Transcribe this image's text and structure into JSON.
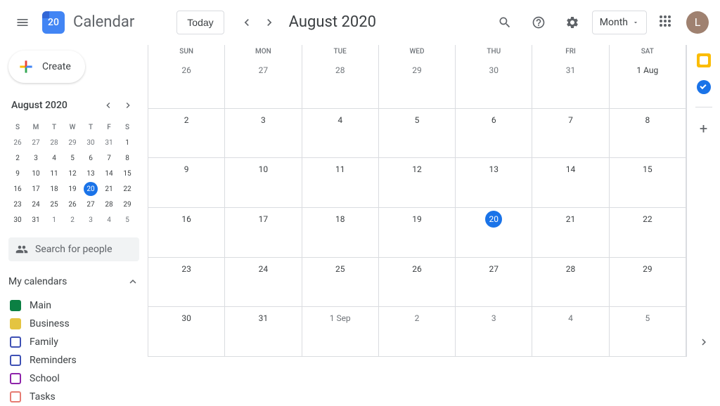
{
  "header": {
    "logo_day": "20",
    "app_name": "Calendar",
    "today_label": "Today",
    "title": "August 2020",
    "view_label": "Month",
    "avatar_letter": "L"
  },
  "sidebar": {
    "create_label": "Create",
    "mini_month": "August 2020",
    "mini_weekdays": [
      "S",
      "M",
      "T",
      "W",
      "T",
      "F",
      "S"
    ],
    "mini_grid": [
      [
        {
          "d": "26",
          "cur": false
        },
        {
          "d": "27",
          "cur": false
        },
        {
          "d": "28",
          "cur": false
        },
        {
          "d": "29",
          "cur": false
        },
        {
          "d": "30",
          "cur": false
        },
        {
          "d": "31",
          "cur": false
        },
        {
          "d": "1",
          "cur": true
        }
      ],
      [
        {
          "d": "2",
          "cur": true
        },
        {
          "d": "3",
          "cur": true
        },
        {
          "d": "4",
          "cur": true
        },
        {
          "d": "5",
          "cur": true
        },
        {
          "d": "6",
          "cur": true
        },
        {
          "d": "7",
          "cur": true
        },
        {
          "d": "8",
          "cur": true
        }
      ],
      [
        {
          "d": "9",
          "cur": true
        },
        {
          "d": "10",
          "cur": true
        },
        {
          "d": "11",
          "cur": true
        },
        {
          "d": "12",
          "cur": true
        },
        {
          "d": "13",
          "cur": true
        },
        {
          "d": "14",
          "cur": true
        },
        {
          "d": "15",
          "cur": true
        }
      ],
      [
        {
          "d": "16",
          "cur": true
        },
        {
          "d": "17",
          "cur": true
        },
        {
          "d": "18",
          "cur": true
        },
        {
          "d": "19",
          "cur": true
        },
        {
          "d": "20",
          "cur": true,
          "today": true
        },
        {
          "d": "21",
          "cur": true
        },
        {
          "d": "22",
          "cur": true
        }
      ],
      [
        {
          "d": "23",
          "cur": true
        },
        {
          "d": "24",
          "cur": true
        },
        {
          "d": "25",
          "cur": true
        },
        {
          "d": "26",
          "cur": true
        },
        {
          "d": "27",
          "cur": true
        },
        {
          "d": "28",
          "cur": true
        },
        {
          "d": "29",
          "cur": true
        }
      ],
      [
        {
          "d": "30",
          "cur": true
        },
        {
          "d": "31",
          "cur": true
        },
        {
          "d": "1",
          "cur": false
        },
        {
          "d": "2",
          "cur": false
        },
        {
          "d": "3",
          "cur": false
        },
        {
          "d": "4",
          "cur": false
        },
        {
          "d": "5",
          "cur": false
        }
      ]
    ],
    "search_placeholder": "Search for people",
    "my_calendars_label": "My calendars",
    "calendars": [
      {
        "name": "Main",
        "color": "#0b8043",
        "checked": true
      },
      {
        "name": "Business",
        "color": "#e4c441",
        "checked": true
      },
      {
        "name": "Family",
        "color": "#3f51b5",
        "checked": false
      },
      {
        "name": "Reminders",
        "color": "#3f51b5",
        "checked": false
      },
      {
        "name": "School",
        "color": "#8e24aa",
        "checked": false
      },
      {
        "name": "Tasks",
        "color": "#e67c73",
        "checked": false
      }
    ]
  },
  "grid": {
    "weekdays": [
      "SUN",
      "MON",
      "TUE",
      "WED",
      "THU",
      "FRI",
      "SAT"
    ],
    "weeks": [
      [
        {
          "d": "26",
          "other": true
        },
        {
          "d": "27",
          "other": true
        },
        {
          "d": "28",
          "other": true
        },
        {
          "d": "29",
          "other": true
        },
        {
          "d": "30",
          "other": true
        },
        {
          "d": "31",
          "other": true
        },
        {
          "d": "1 Aug"
        }
      ],
      [
        {
          "d": "2"
        },
        {
          "d": "3"
        },
        {
          "d": "4"
        },
        {
          "d": "5"
        },
        {
          "d": "6"
        },
        {
          "d": "7"
        },
        {
          "d": "8"
        }
      ],
      [
        {
          "d": "9"
        },
        {
          "d": "10"
        },
        {
          "d": "11"
        },
        {
          "d": "12"
        },
        {
          "d": "13"
        },
        {
          "d": "14"
        },
        {
          "d": "15"
        }
      ],
      [
        {
          "d": "16"
        },
        {
          "d": "17"
        },
        {
          "d": "18"
        },
        {
          "d": "19"
        },
        {
          "d": "20",
          "today": true
        },
        {
          "d": "21"
        },
        {
          "d": "22"
        }
      ],
      [
        {
          "d": "23"
        },
        {
          "d": "24"
        },
        {
          "d": "25"
        },
        {
          "d": "26"
        },
        {
          "d": "27"
        },
        {
          "d": "28"
        },
        {
          "d": "29"
        }
      ],
      [
        {
          "d": "30"
        },
        {
          "d": "31"
        },
        {
          "d": "1 Sep",
          "other": true
        },
        {
          "d": "2",
          "other": true
        },
        {
          "d": "3",
          "other": true
        },
        {
          "d": "4",
          "other": true
        },
        {
          "d": "5",
          "other": true
        }
      ]
    ]
  }
}
